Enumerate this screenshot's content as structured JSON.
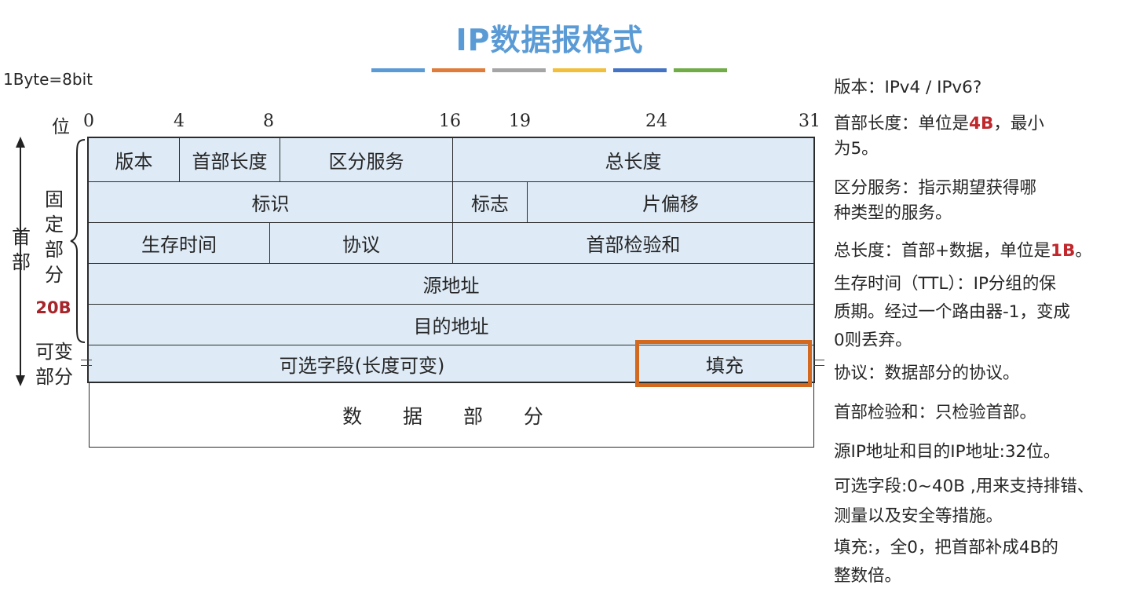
{
  "title": "IP数据报格式",
  "unit_note": "1Byte=8bit",
  "color_bar_colors": [
    "#5b9bd5",
    "#e07b39",
    "#a5a5a5",
    "#f2bf3b",
    "#4472c4",
    "#70ad47"
  ],
  "bit_axis": {
    "label": "位",
    "numbers": [
      "0",
      "4",
      "8",
      "16",
      "19",
      "24",
      "31"
    ]
  },
  "rows": [
    {
      "cells": [
        "版本",
        "首部长度",
        "区分服务",
        "总长度"
      ]
    },
    {
      "cells": [
        "标识",
        "标志",
        "片偏移"
      ]
    },
    {
      "cells": [
        "生存时间",
        "协议",
        "首部检验和"
      ]
    },
    {
      "cells": [
        "源地址"
      ]
    },
    {
      "cells": [
        "目的地址"
      ]
    },
    {
      "cells": [
        "可选字段(长度可变)",
        "填充"
      ]
    }
  ],
  "data_section": "数 据 部 分",
  "side_labels": {
    "header": "首部",
    "fixed_part": "固定部分",
    "fixed_size": "20B",
    "variable_part": "可变部分"
  },
  "notes": [
    {
      "text": "版本：IPv4 / IPv6?"
    },
    {
      "pre": "首部长度：单位是",
      "hl": "4B",
      "post": "，最小"
    },
    {
      "text": "为5。"
    },
    {
      "text": "区分服务：指示期望获得哪"
    },
    {
      "text": "种类型的服务。"
    },
    {
      "pre": "总长度：首部+数据，单位是",
      "hl": "1B",
      "post": "。"
    },
    {
      "text": "生存时间（TTL）：IP分组的保"
    },
    {
      "text": "质期。经过一个路由器-1，变成"
    },
    {
      "text": "0则丢弃。"
    },
    {
      "text": "协议：数据部分的协议。"
    },
    {
      "text": "首部检验和：只检验首部。"
    },
    {
      "text": "源IP地址和目的IP地址:32位。"
    },
    {
      "text": "可选字段:0~40B ,用来支持排错、"
    },
    {
      "text": "测量以及安全等措施。"
    },
    {
      "text": "填充:，全0，把首部补成4B的"
    },
    {
      "text": "整数倍。"
    }
  ]
}
